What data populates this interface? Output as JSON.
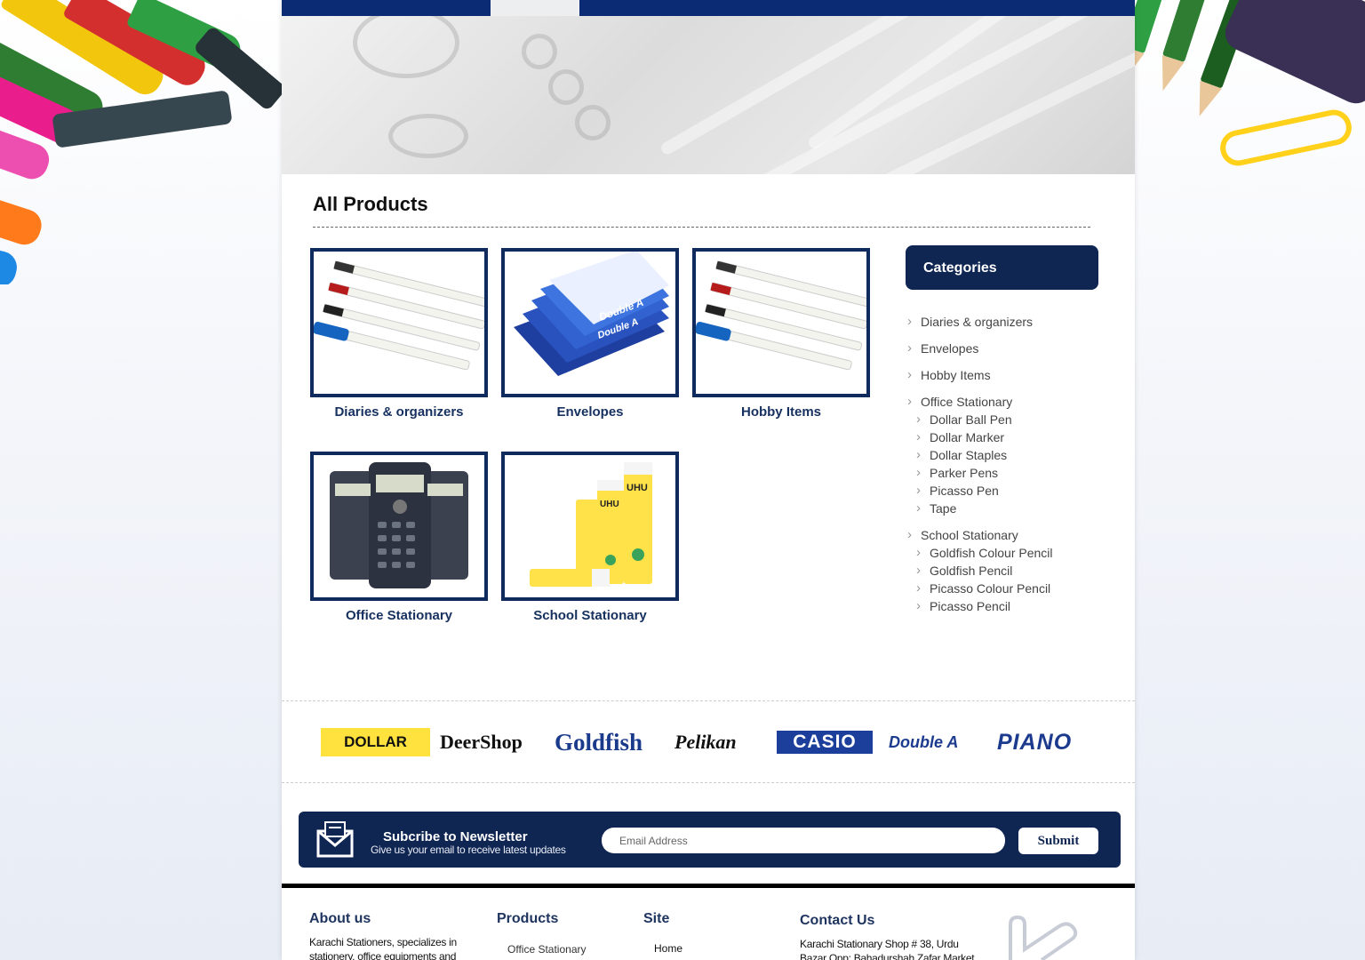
{
  "page_title": "All Products",
  "products": [
    {
      "label": "Diaries & organizers",
      "image": "pens"
    },
    {
      "label": "Envelopes",
      "image": "paper-reams"
    },
    {
      "label": "Hobby Items",
      "image": "pens"
    },
    {
      "label": "Office Stationary",
      "image": "calculators"
    },
    {
      "label": "School Stationary",
      "image": "glue-sticks"
    }
  ],
  "sidebar": {
    "title": "Categories",
    "items": [
      {
        "label": "Diaries & organizers",
        "level": 0
      },
      {
        "label": "Envelopes",
        "level": 0
      },
      {
        "label": "Hobby Items",
        "level": 0
      },
      {
        "label": "Office Stationary",
        "level": 0
      },
      {
        "label": "Dollar Ball Pen",
        "level": 1
      },
      {
        "label": "Dollar Marker",
        "level": 1
      },
      {
        "label": "Dollar Staples",
        "level": 1
      },
      {
        "label": "Parker Pens",
        "level": 1
      },
      {
        "label": "Picasso Pen",
        "level": 1
      },
      {
        "label": "Tape",
        "level": 1
      },
      {
        "label": "School Stationary",
        "level": 0
      },
      {
        "label": "Goldfish Colour Pencil",
        "level": 1
      },
      {
        "label": "Goldfish Pencil",
        "level": 1
      },
      {
        "label": "Picasso Colour Pencil",
        "level": 1
      },
      {
        "label": "Picasso Pencil",
        "level": 1
      }
    ]
  },
  "brands": [
    {
      "name": "DOLLAR"
    },
    {
      "name": "DeerShop"
    },
    {
      "name": "Goldfish"
    },
    {
      "name": "Pelikan"
    },
    {
      "name": "CASIO"
    },
    {
      "name": "Double A"
    },
    {
      "name": "PIANO"
    }
  ],
  "newsletter": {
    "title": "Subcribe to Newsletter",
    "subtitle": "Give us your email to receive latest updates",
    "placeholder": "Email Address",
    "submit_label": "Submit"
  },
  "footer": {
    "about_title": "About us",
    "about_text": "Karachi Stationers, specializes in stationery, office equipments and",
    "products_title": "Products",
    "products_link": "Office Stationary",
    "site_title": "Site",
    "site_link": "Home",
    "contact_title": "Contact Us",
    "contact_text": "Karachi Stationary Shop # 38, Urdu Bazar Opp: Bahadurshah Zafar Market"
  },
  "colors": {
    "navy": "#0f2552",
    "topbar": "#0b2c74",
    "caption": "#16305f"
  }
}
